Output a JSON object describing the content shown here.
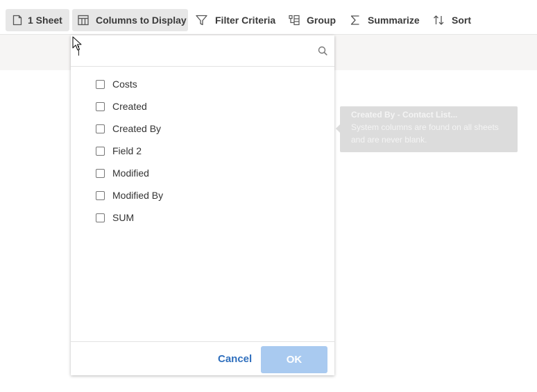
{
  "toolbar": {
    "items": [
      {
        "label": "1 Sheet",
        "icon": "sheet-icon",
        "active": true
      },
      {
        "label": "Columns to Display",
        "icon": "columns-icon",
        "active": true
      },
      {
        "label": "Filter Criteria",
        "icon": "filter-icon",
        "active": false
      },
      {
        "label": "Group",
        "icon": "group-icon",
        "active": false
      },
      {
        "label": "Summarize",
        "icon": "sigma-icon",
        "active": false
      },
      {
        "label": "Sort",
        "icon": "sort-icon",
        "active": false
      }
    ]
  },
  "columns_dropdown": {
    "search": {
      "value": "",
      "placeholder": ""
    },
    "columns": [
      {
        "label": "Costs",
        "checked": false
      },
      {
        "label": "Created",
        "checked": false
      },
      {
        "label": "Created By",
        "checked": false
      },
      {
        "label": "Field 2",
        "checked": false
      },
      {
        "label": "Modified",
        "checked": false
      },
      {
        "label": "Modified By",
        "checked": false
      },
      {
        "label": "SUM",
        "checked": false
      }
    ],
    "cancel_label": "Cancel",
    "ok_label": "OK"
  },
  "tooltip": {
    "title": "Created By - Contact List...",
    "body": "System columns are found on all sheets and are never blank."
  },
  "colors": {
    "accent": "#2f6fbd",
    "ok_disabled": "#a9caf0",
    "toolbar_active": "#e7e7e7",
    "tooltip_bg": "#dcdcdc"
  }
}
